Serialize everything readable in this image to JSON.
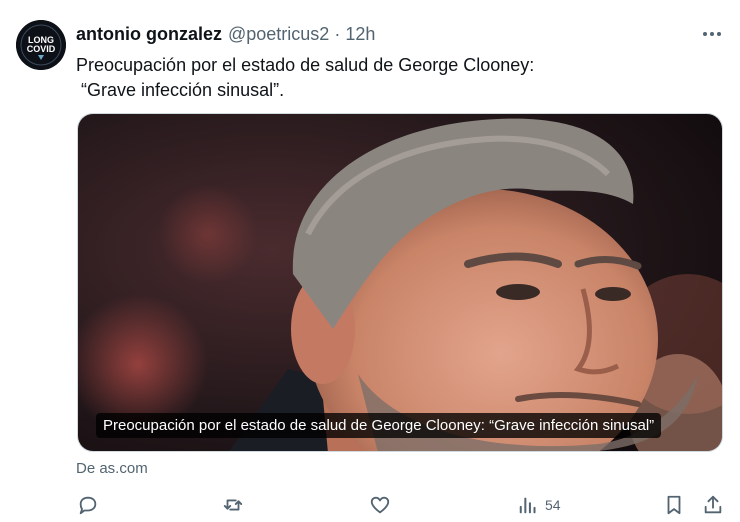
{
  "tweet": {
    "author": {
      "name": "antonio gonzalez",
      "handle": "@poetricus2",
      "avatar_text_top": "LONG",
      "avatar_text_bottom": "COVID"
    },
    "separator": "·",
    "time": "12h",
    "text": "Preocupación por el estado de salud de George Clooney:\n “Grave infección sinusal”.",
    "card": {
      "caption": "Preocupación por el estado de salud de George Clooney: “Grave infección sinusal”",
      "source": "De as.com"
    },
    "actions": {
      "views": "54"
    },
    "icons": {
      "more": "more-icon",
      "reply": "reply-icon",
      "retweet": "retweet-icon",
      "like": "heart-icon",
      "views": "views-icon",
      "bookmark": "bookmark-icon",
      "share": "share-icon"
    },
    "colors": {
      "text": "#0f1419",
      "secondary": "#536471"
    }
  }
}
